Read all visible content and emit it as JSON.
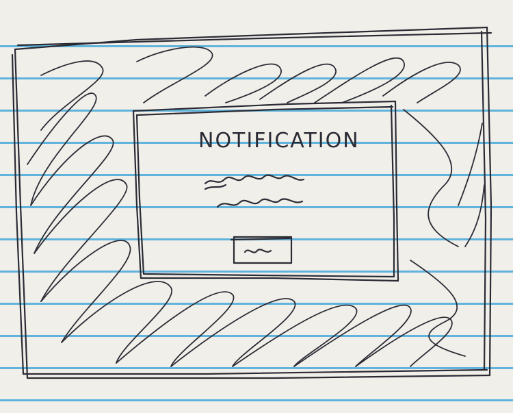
{
  "notification": {
    "title": "NOTIFICATION"
  },
  "colors": {
    "paper": "#f1efe9",
    "ruled_line": "#5fb3dc",
    "ink": "#2b2b35"
  },
  "icons": {
    "body_text": "squiggle-text-icon",
    "button": "squiggle-button-icon"
  }
}
